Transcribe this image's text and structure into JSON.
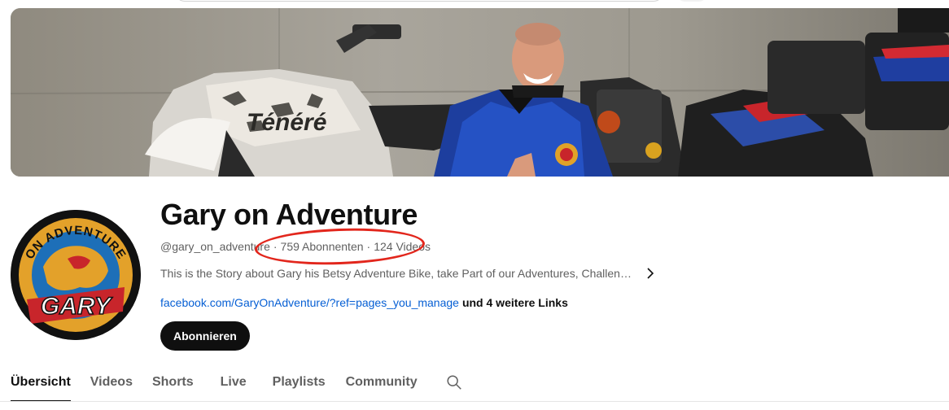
{
  "channel": {
    "name": "Gary on Adventure",
    "handle": "@gary_on_adventure",
    "separator": "·",
    "subscribers": "759 Abonnenten",
    "videos": "124 Videos",
    "description": "This is the Story about Gary his Betsy Adventure Bike, take Part of our Adventures, Challen…",
    "link": "facebook.com/GaryOnAdventure/?ref=pages_you_manage",
    "more_links": "und 4 weitere Links",
    "subscribe_label": "Abonnieren"
  },
  "avatar": {
    "logo_text_top": "ON ADVENTURE",
    "logo_text_bottom": "GARY"
  },
  "tabs": [
    {
      "label": "Übersicht",
      "active": true
    },
    {
      "label": "Videos",
      "active": false
    },
    {
      "label": "Shorts",
      "active": false
    },
    {
      "label": "Live",
      "active": false
    },
    {
      "label": "Playlists",
      "active": false
    },
    {
      "label": "Community",
      "active": false
    }
  ],
  "icons": {
    "search": "search-icon",
    "chevron": "chevron-right-icon"
  },
  "colors": {
    "link": "#065fd4",
    "highlight": "#e2261c",
    "subscribe_bg": "#0f0f0f"
  }
}
